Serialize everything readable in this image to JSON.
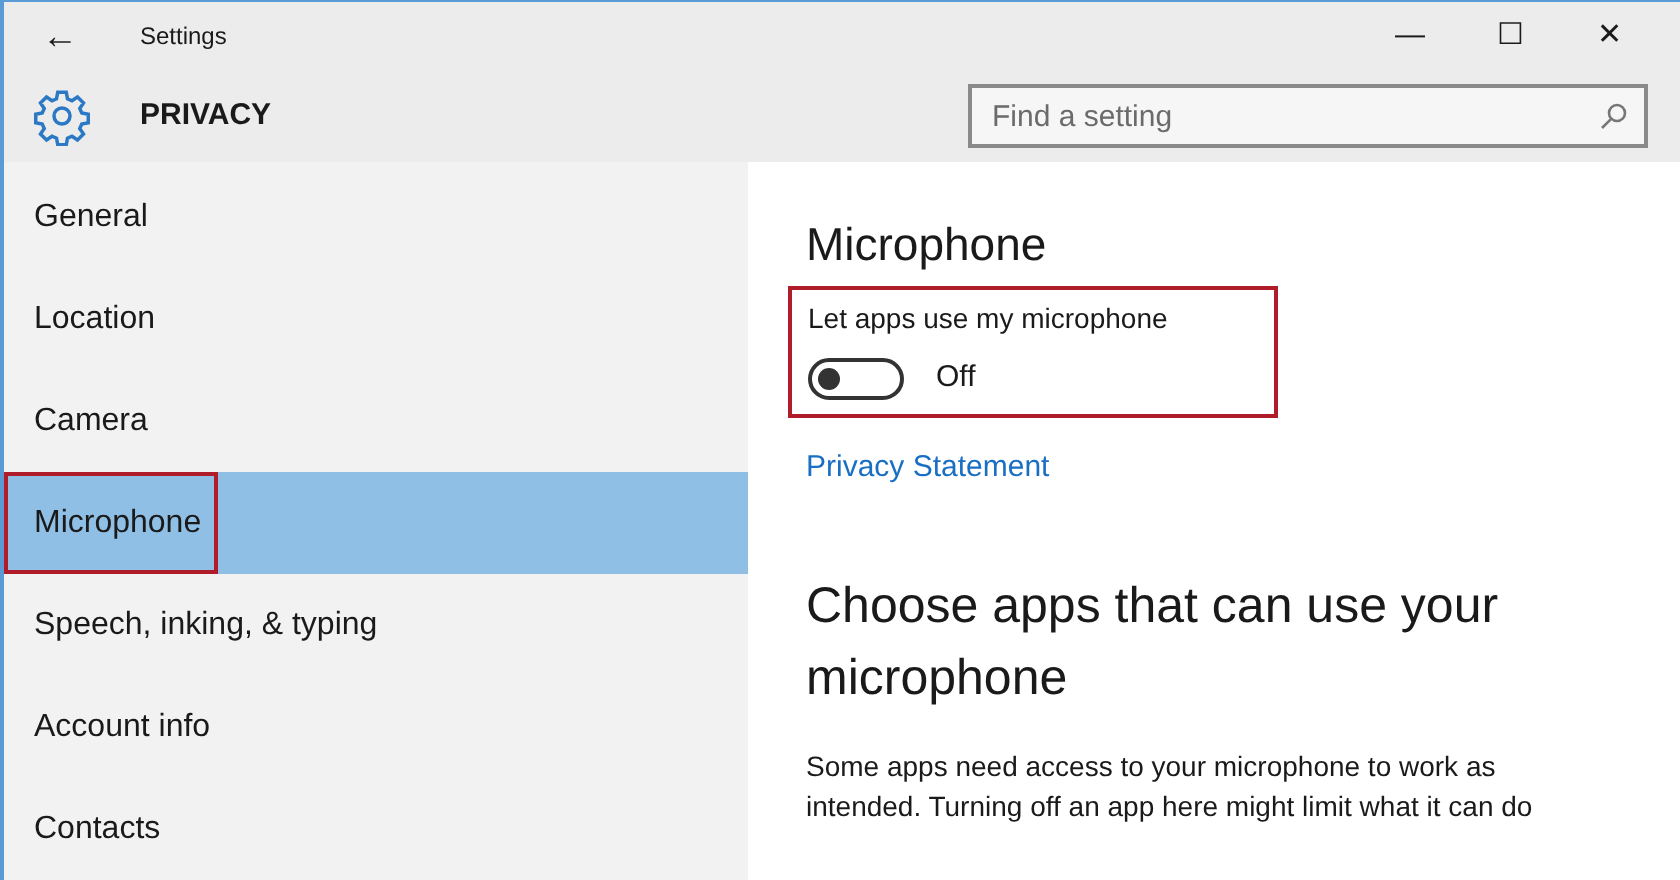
{
  "window": {
    "title": "Settings",
    "back": "←",
    "controls": [
      "—",
      "☐",
      "✕"
    ]
  },
  "header": {
    "title": "PRIVACY"
  },
  "search": {
    "placeholder": "Find a setting"
  },
  "sidebar": {
    "items": [
      {
        "label": "General",
        "selected": false,
        "highlighted": false
      },
      {
        "label": "Location",
        "selected": false,
        "highlighted": false
      },
      {
        "label": "Camera",
        "selected": false,
        "highlighted": false
      },
      {
        "label": "Microphone",
        "selected": true,
        "highlighted": true
      },
      {
        "label": "Speech, inking, & typing",
        "selected": false,
        "highlighted": false
      },
      {
        "label": "Account info",
        "selected": false,
        "highlighted": false
      },
      {
        "label": "Contacts",
        "selected": false,
        "highlighted": false
      }
    ]
  },
  "content": {
    "title": "Microphone",
    "setting": {
      "label": "Let apps use my microphone",
      "on": false,
      "state_text": "Off",
      "highlighted": true
    },
    "link": "Privacy Statement",
    "section_title": "Choose apps that can use your microphone",
    "description": "Some apps need access to your microphone to work as intended. Turning off an app here might limit what it can do"
  }
}
